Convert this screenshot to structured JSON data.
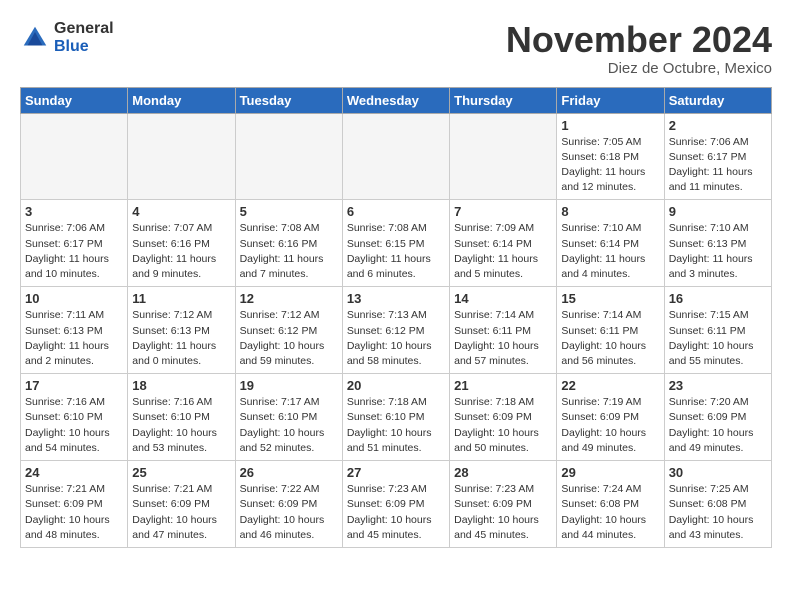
{
  "header": {
    "logo_general": "General",
    "logo_blue": "Blue",
    "month_title": "November 2024",
    "subtitle": "Diez de Octubre, Mexico"
  },
  "weekdays": [
    "Sunday",
    "Monday",
    "Tuesday",
    "Wednesday",
    "Thursday",
    "Friday",
    "Saturday"
  ],
  "weeks": [
    [
      {
        "day": "",
        "info": ""
      },
      {
        "day": "",
        "info": ""
      },
      {
        "day": "",
        "info": ""
      },
      {
        "day": "",
        "info": ""
      },
      {
        "day": "",
        "info": ""
      },
      {
        "day": "1",
        "info": "Sunrise: 7:05 AM\nSunset: 6:18 PM\nDaylight: 11 hours and 12 minutes."
      },
      {
        "day": "2",
        "info": "Sunrise: 7:06 AM\nSunset: 6:17 PM\nDaylight: 11 hours and 11 minutes."
      }
    ],
    [
      {
        "day": "3",
        "info": "Sunrise: 7:06 AM\nSunset: 6:17 PM\nDaylight: 11 hours and 10 minutes."
      },
      {
        "day": "4",
        "info": "Sunrise: 7:07 AM\nSunset: 6:16 PM\nDaylight: 11 hours and 9 minutes."
      },
      {
        "day": "5",
        "info": "Sunrise: 7:08 AM\nSunset: 6:16 PM\nDaylight: 11 hours and 7 minutes."
      },
      {
        "day": "6",
        "info": "Sunrise: 7:08 AM\nSunset: 6:15 PM\nDaylight: 11 hours and 6 minutes."
      },
      {
        "day": "7",
        "info": "Sunrise: 7:09 AM\nSunset: 6:14 PM\nDaylight: 11 hours and 5 minutes."
      },
      {
        "day": "8",
        "info": "Sunrise: 7:10 AM\nSunset: 6:14 PM\nDaylight: 11 hours and 4 minutes."
      },
      {
        "day": "9",
        "info": "Sunrise: 7:10 AM\nSunset: 6:13 PM\nDaylight: 11 hours and 3 minutes."
      }
    ],
    [
      {
        "day": "10",
        "info": "Sunrise: 7:11 AM\nSunset: 6:13 PM\nDaylight: 11 hours and 2 minutes."
      },
      {
        "day": "11",
        "info": "Sunrise: 7:12 AM\nSunset: 6:13 PM\nDaylight: 11 hours and 0 minutes."
      },
      {
        "day": "12",
        "info": "Sunrise: 7:12 AM\nSunset: 6:12 PM\nDaylight: 10 hours and 59 minutes."
      },
      {
        "day": "13",
        "info": "Sunrise: 7:13 AM\nSunset: 6:12 PM\nDaylight: 10 hours and 58 minutes."
      },
      {
        "day": "14",
        "info": "Sunrise: 7:14 AM\nSunset: 6:11 PM\nDaylight: 10 hours and 57 minutes."
      },
      {
        "day": "15",
        "info": "Sunrise: 7:14 AM\nSunset: 6:11 PM\nDaylight: 10 hours and 56 minutes."
      },
      {
        "day": "16",
        "info": "Sunrise: 7:15 AM\nSunset: 6:11 PM\nDaylight: 10 hours and 55 minutes."
      }
    ],
    [
      {
        "day": "17",
        "info": "Sunrise: 7:16 AM\nSunset: 6:10 PM\nDaylight: 10 hours and 54 minutes."
      },
      {
        "day": "18",
        "info": "Sunrise: 7:16 AM\nSunset: 6:10 PM\nDaylight: 10 hours and 53 minutes."
      },
      {
        "day": "19",
        "info": "Sunrise: 7:17 AM\nSunset: 6:10 PM\nDaylight: 10 hours and 52 minutes."
      },
      {
        "day": "20",
        "info": "Sunrise: 7:18 AM\nSunset: 6:10 PM\nDaylight: 10 hours and 51 minutes."
      },
      {
        "day": "21",
        "info": "Sunrise: 7:18 AM\nSunset: 6:09 PM\nDaylight: 10 hours and 50 minutes."
      },
      {
        "day": "22",
        "info": "Sunrise: 7:19 AM\nSunset: 6:09 PM\nDaylight: 10 hours and 49 minutes."
      },
      {
        "day": "23",
        "info": "Sunrise: 7:20 AM\nSunset: 6:09 PM\nDaylight: 10 hours and 49 minutes."
      }
    ],
    [
      {
        "day": "24",
        "info": "Sunrise: 7:21 AM\nSunset: 6:09 PM\nDaylight: 10 hours and 48 minutes."
      },
      {
        "day": "25",
        "info": "Sunrise: 7:21 AM\nSunset: 6:09 PM\nDaylight: 10 hours and 47 minutes."
      },
      {
        "day": "26",
        "info": "Sunrise: 7:22 AM\nSunset: 6:09 PM\nDaylight: 10 hours and 46 minutes."
      },
      {
        "day": "27",
        "info": "Sunrise: 7:23 AM\nSunset: 6:09 PM\nDaylight: 10 hours and 45 minutes."
      },
      {
        "day": "28",
        "info": "Sunrise: 7:23 AM\nSunset: 6:09 PM\nDaylight: 10 hours and 45 minutes."
      },
      {
        "day": "29",
        "info": "Sunrise: 7:24 AM\nSunset: 6:08 PM\nDaylight: 10 hours and 44 minutes."
      },
      {
        "day": "30",
        "info": "Sunrise: 7:25 AM\nSunset: 6:08 PM\nDaylight: 10 hours and 43 minutes."
      }
    ]
  ]
}
